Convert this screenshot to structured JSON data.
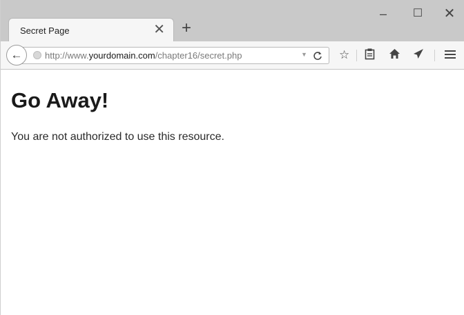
{
  "window": {
    "controls": {
      "minimize": "–",
      "maximize": "☐",
      "close": "✕"
    }
  },
  "tab": {
    "title": "Secret Page",
    "close": "✕",
    "new_tab": "+"
  },
  "toolbar": {
    "back": "←",
    "url_prefix": "http://www.",
    "url_host": "yourdomain.com",
    "url_path": "/chapter16/secret.php",
    "dropmarker": "▼",
    "reload": "C",
    "icons": [
      "star-icon",
      "clipboard-icon",
      "home-icon",
      "send-icon",
      "menu-icon"
    ]
  },
  "page": {
    "heading": "Go Away!",
    "message": "You are not authorized to use this resource."
  }
}
